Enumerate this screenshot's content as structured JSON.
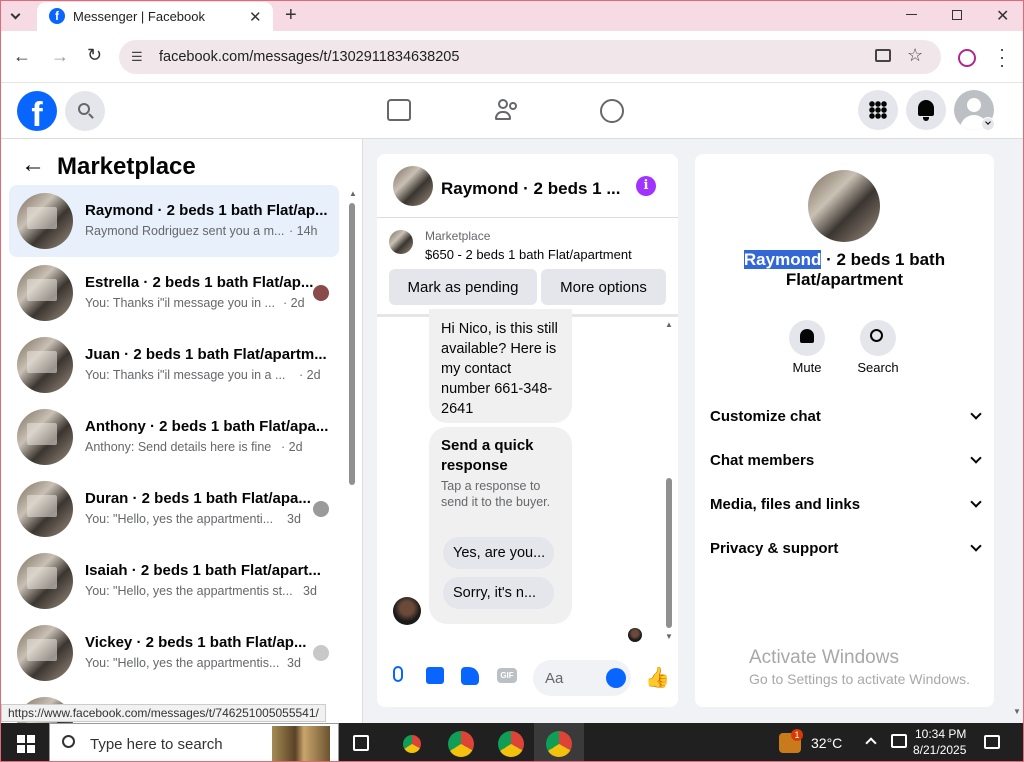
{
  "browser": {
    "tab_title": "Messenger | Facebook",
    "url": "facebook.com/messages/t/1302911834638205",
    "status_url": "https://www.facebook.com/messages/t/746251005055541/"
  },
  "left": {
    "title": "Marketplace",
    "conversations": [
      {
        "name": "Raymond · 2 beds 1 bath Flat/ap...",
        "preview": "Raymond Rodriguez sent you a m...",
        "time": "· 14h"
      },
      {
        "name": "Estrella · 2 beds 1 bath Flat/ap...",
        "preview": "You: Thanks i\"il message you in ...",
        "time": "· 2d"
      },
      {
        "name": "Juan · 2 beds 1 bath Flat/apartm...",
        "preview": "You: Thanks i\"il message you in a ...",
        "time": "· 2d"
      },
      {
        "name": "Anthony · 2 beds 1 bath Flat/apa...",
        "preview": "Anthony: Send details here is fine",
        "time": "· 2d"
      },
      {
        "name": "Duran · 2 beds 1 bath Flat/apa...",
        "preview": "You: \"Hello, yes the appartmenti...",
        "time": "3d"
      },
      {
        "name": "Isaiah · 2 beds 1 bath Flat/apart...",
        "preview": "You: \"Hello, yes the appartmentis st...",
        "time": "3d"
      },
      {
        "name": "Vickey · 2 beds 1 bath Flat/ap...",
        "preview": "You: \"Hello, yes the appartmentis...",
        "time": "3d"
      }
    ]
  },
  "chat": {
    "header_title": "Raymond · 2 beds 1 ...",
    "listing_source": "Marketplace",
    "listing_title": "$650 - 2 beds 1 bath Flat/apartment",
    "mark_pending": "Mark as pending",
    "more_options": "More options",
    "message": "Hi Nico, is this still available? Here is my contact number 661-348-2641",
    "quick_title": "Send a quick response",
    "quick_sub": "Tap a response to send it to the buyer.",
    "quick_1": "Yes, are you...",
    "quick_2": "Sorry, it's n...",
    "composer_placeholder": "Aa"
  },
  "info": {
    "name_highlight": "Raymond",
    "name_rest": " · 2 beds 1 bath",
    "name_line2": "Flat/apartment",
    "mute": "Mute",
    "search": "Search",
    "sections": [
      "Customize chat",
      "Chat members",
      "Media, files and links",
      "Privacy & support"
    ]
  },
  "watermark": {
    "title": "Activate Windows",
    "sub": "Go to Settings to activate Windows."
  },
  "taskbar": {
    "search": "Type here to search",
    "temp": "32°C",
    "time": "10:34 PM",
    "date": "8/21/2025",
    "badge": "1"
  },
  "colors": {
    "fb_blue": "#0866ff",
    "purple": "#a033ff",
    "taskbar": "#202020"
  }
}
